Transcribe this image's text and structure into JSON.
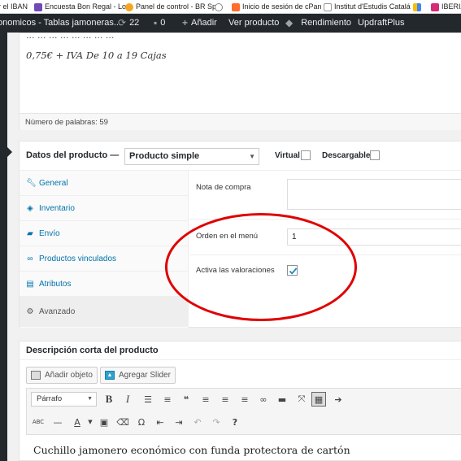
{
  "bookmarks": [
    {
      "label": "r el IBAN",
      "icon": "none",
      "color": "#ffffff"
    },
    {
      "label": "Encuesta Bon Regal - Lo",
      "icon": "form-icon",
      "color": "#7248b9"
    },
    {
      "label": "Panel de control - BR Sp",
      "icon": "joomla-icon",
      "color": "#f4a61d"
    },
    {
      "label": "",
      "icon": "history-icon",
      "color": "#888888"
    },
    {
      "label": "Inicio de sesión de cPan",
      "icon": "cpanel-icon",
      "color": "#ff6c2c"
    },
    {
      "label": "Institut d'Estudis Catalá",
      "icon": "document-icon",
      "color": "#999999"
    },
    {
      "label": "",
      "icon": "google-ads-icon",
      "color": "#4285f4"
    },
    {
      "label": "IBERIA",
      "icon": "instagram-icon",
      "color": "#d62976"
    }
  ],
  "adminbar": {
    "site_name": "onomicos - Tablas jamoneras...",
    "updates_count": "22",
    "comments_count": "0",
    "add_label": "Añadir",
    "view_product": "Ver producto",
    "performance": "Rendimiento",
    "updraft": "UpdraftPlus"
  },
  "editor": {
    "cut_line": "... ... ... ... ... ... ... ...",
    "price_line": "0,75€ + IVA De 10 a 19 Cajas",
    "word_count": "Número de palabras: 59"
  },
  "product_data": {
    "title": "Datos del producto —",
    "product_type": "Producto simple",
    "virtual_label": "Virtual:",
    "downloadable_label": "Descargable:",
    "tabs": [
      {
        "label": "General",
        "icon": "wrench-icon"
      },
      {
        "label": "Inventario",
        "icon": "tag-icon"
      },
      {
        "label": "Envío",
        "icon": "truck-icon"
      },
      {
        "label": "Productos vinculados",
        "icon": "link-icon"
      },
      {
        "label": "Atributos",
        "icon": "table-icon"
      },
      {
        "label": "Avanzado",
        "icon": "gear-icon"
      }
    ],
    "purchase_note_label": "Nota de compra",
    "menu_order_label": "Orden en el menú",
    "menu_order_value": "1",
    "reviews_label": "Activa las valoraciones",
    "reviews_enabled": true
  },
  "short_description": {
    "title": "Descripción corta del producto",
    "add_media": "Añadir objeto",
    "add_slider": "Agregar Slider",
    "format_select": "Párrafo",
    "content": "Cuchillo jamonero económico con funda protectora de cartón"
  },
  "colors": {
    "admin_bar": "#23282d",
    "link": "#0073aa",
    "annotation": "#e00000"
  }
}
